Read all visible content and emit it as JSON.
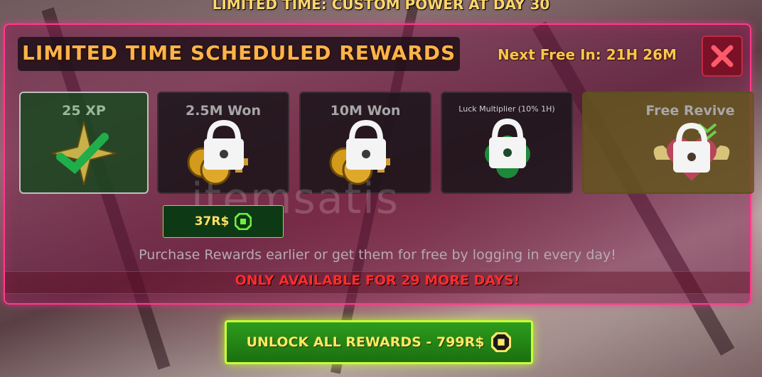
{
  "banner": "LIMITED TIME: CUSTOM POWER AT DAY 30",
  "panel": {
    "title": "LIMITED TIME SCHEDULED REWARDS",
    "next_free": "Next Free In: 21H 26M",
    "close_icon": "close-x-icon"
  },
  "rewards": [
    {
      "label": "25 XP",
      "state": "claimed",
      "icon": "xp-star-checkmark-icon"
    },
    {
      "label": "2.5M Won",
      "state": "locked",
      "icon": "coins-lock-icon"
    },
    {
      "label": "10M Won",
      "state": "locked",
      "icon": "coins-lock-icon"
    },
    {
      "label": "Luck Multiplier (10% 1H)",
      "state": "locked",
      "icon": "clover-lock-icon"
    },
    {
      "label": "Free Revive",
      "state": "locked",
      "icon": "heart-wings-lock-icon"
    }
  ],
  "price": {
    "amount": "37R$",
    "icon": "robux-icon"
  },
  "purchase_note": "Purchase Rewards earlier or get them for free by logging in every day!",
  "availability": "ONLY AVAILABLE FOR 29 MORE DAYS!",
  "unlock_button": {
    "label": "UNLOCK ALL REWARDS -  799R$",
    "icon": "robux-icon"
  },
  "colors": {
    "accent_pink": "#ff3b8a",
    "title_orange": "#ffb34a",
    "button_green": "#2c9c1c",
    "warning_red": "#ff2d2d"
  }
}
